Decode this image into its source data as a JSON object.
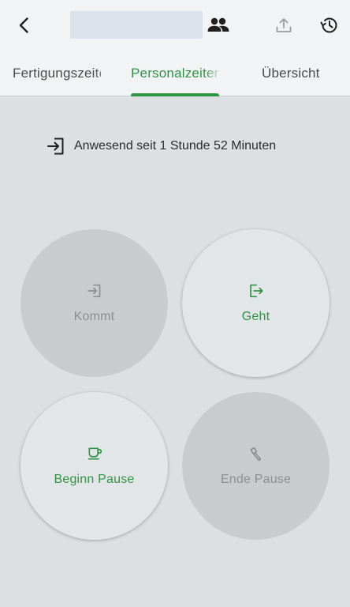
{
  "header": {
    "back_icon": "chevron-left-icon",
    "title": "",
    "actions": [
      "people-icon",
      "upload-icon",
      "history-icon"
    ]
  },
  "tabs": [
    {
      "label": "Fertigungszeiten",
      "active": false
    },
    {
      "label": "Personalzeiten",
      "active": true
    },
    {
      "label": "Übersicht",
      "active": false
    }
  ],
  "status": {
    "icon": "login-icon",
    "text": "Anwesend seit 1 Stunde 52 Minuten"
  },
  "actions": {
    "kommt": {
      "label": "Kommt",
      "icon": "login-icon",
      "enabled": false
    },
    "geht": {
      "label": "Geht",
      "icon": "logout-icon",
      "enabled": true
    },
    "beginn_pause": {
      "label": "Beginn Pause",
      "icon": "coffee-cup-icon",
      "enabled": true
    },
    "ende_pause": {
      "label": "Ende Pause",
      "icon": "broom-icon",
      "enabled": false
    }
  },
  "colors": {
    "accent": "#2e9442",
    "background": "#dde0e3",
    "header_background": "#f1f3f4",
    "disabled_circle": "#c9cccf",
    "enabled_circle": "#e3e6e9",
    "disabled_text": "#8c8e91"
  }
}
